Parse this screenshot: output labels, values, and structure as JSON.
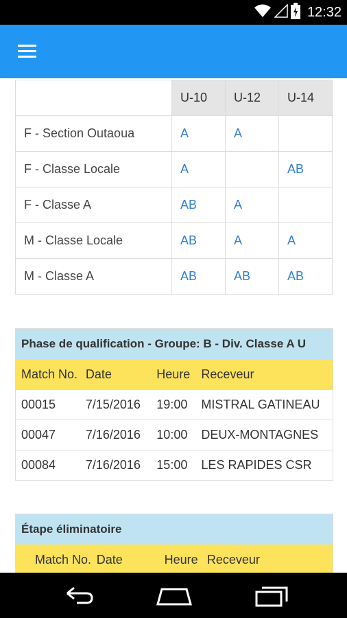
{
  "status_bar": {
    "time": "12:32",
    "icons": [
      "wifi-icon",
      "signal-icon",
      "battery-icon"
    ]
  },
  "app_bar": {
    "menu_icon": "hamburger-icon",
    "color": "#2196f3"
  },
  "category_table": {
    "columns": [
      "U-10",
      "U-12",
      "U-14"
    ],
    "rows": [
      {
        "label": "F - Section Outaoua",
        "values": [
          "A",
          "A",
          ""
        ]
      },
      {
        "label": "F - Classe Locale",
        "values": [
          "A",
          "",
          "AB"
        ]
      },
      {
        "label": "F - Classe A",
        "values": [
          "AB",
          "A",
          ""
        ]
      },
      {
        "label": "M - Classe Locale",
        "values": [
          "AB",
          "A",
          "A"
        ]
      },
      {
        "label": "M - Classe A",
        "values": [
          "AB",
          "AB",
          "AB"
        ]
      }
    ]
  },
  "qualification": {
    "title": "Phase de qualification - Groupe: B - Div. Classe A U",
    "headers": {
      "match_no": "Match No.",
      "date": "Date",
      "time": "Heure",
      "home": "Receveur"
    },
    "rows": [
      {
        "match_no": "00015",
        "date": "7/15/2016",
        "time": "19:00",
        "home": "MISTRAL GATINEAU"
      },
      {
        "match_no": "00047",
        "date": "7/16/2016",
        "time": "10:00",
        "home": "DEUX-MONTAGNES"
      },
      {
        "match_no": "00084",
        "date": "7/16/2016",
        "time": "15:00",
        "home": "LES RAPIDES CSR"
      }
    ]
  },
  "elimination": {
    "title": "Étape éliminatoire",
    "headers": {
      "match_no": "Match No.",
      "date": "Date",
      "time": "Heure",
      "home": "Receveur"
    }
  },
  "nav_bar": {
    "icons": [
      "back-icon",
      "home-icon",
      "recent-apps-icon"
    ]
  },
  "colors": {
    "link": "#2f7fd0",
    "header_yellow": "#fde35c",
    "title_blue": "#bfe3f0"
  }
}
